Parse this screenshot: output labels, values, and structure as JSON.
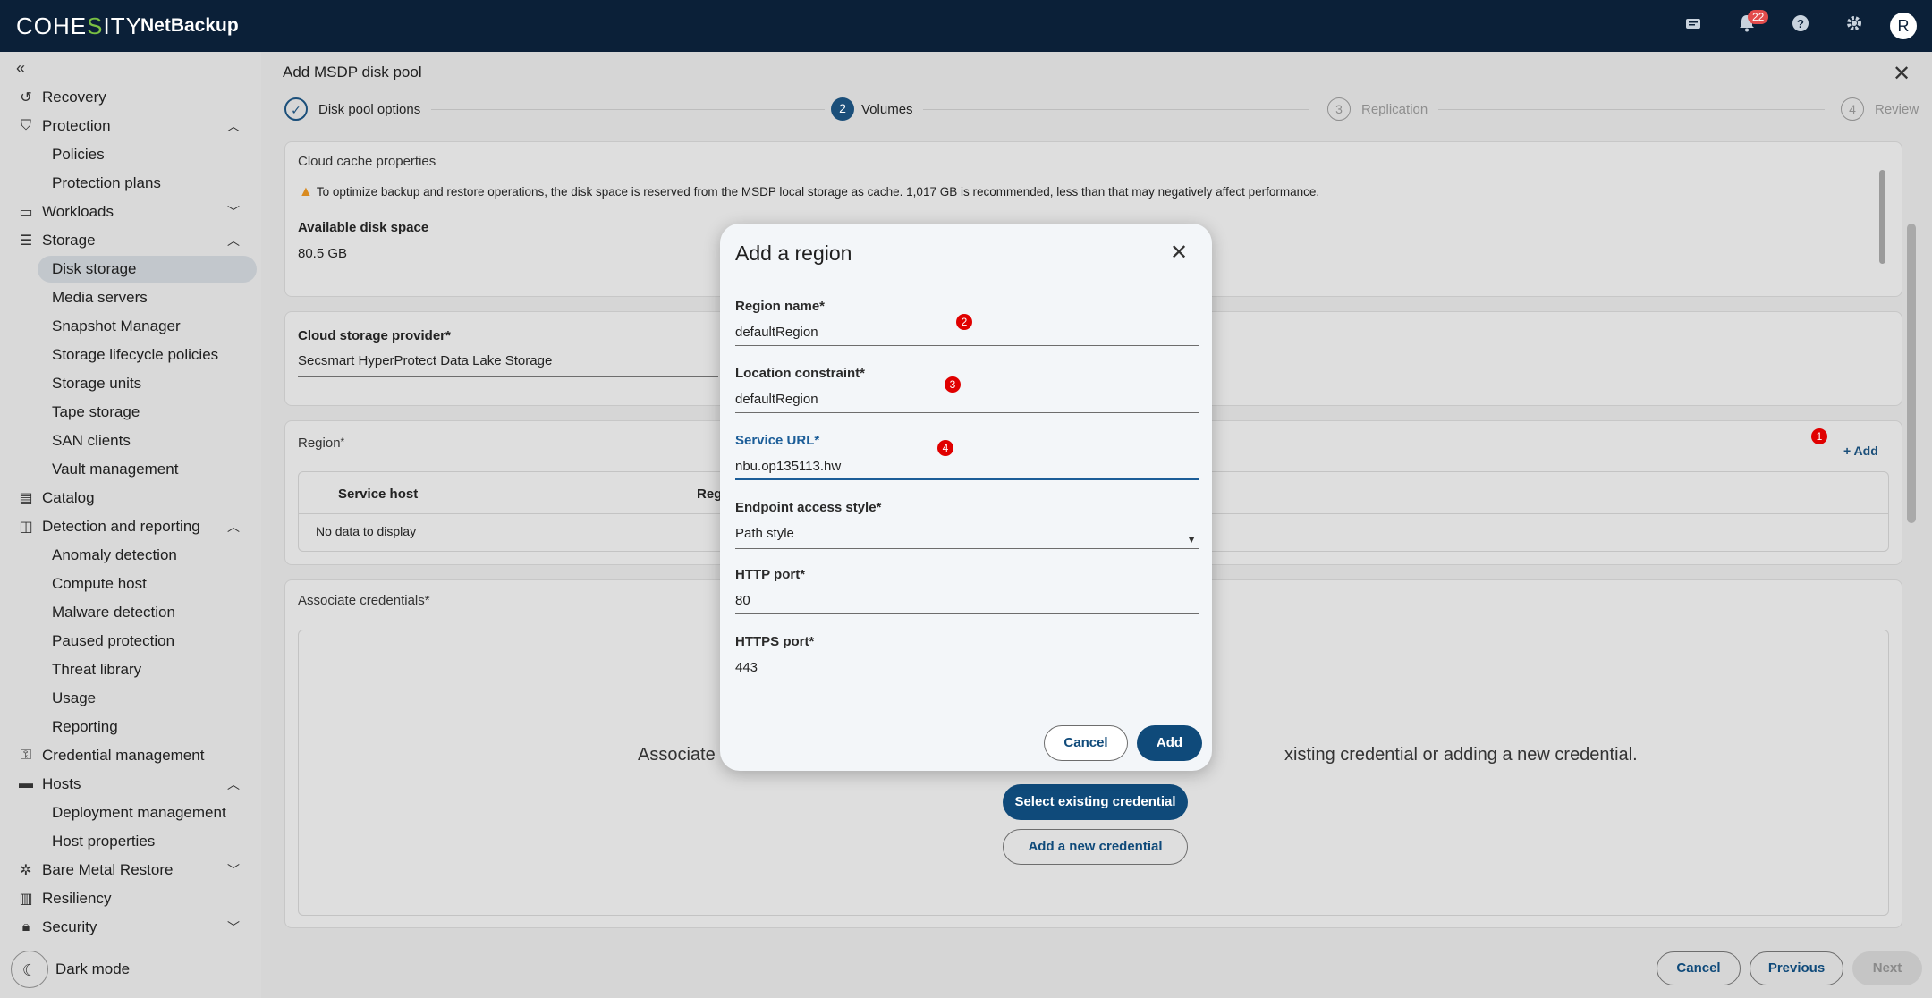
{
  "header": {
    "logo_prefix": "COHE",
    "logo_accent": "S",
    "logo_suffix": "ITY",
    "product": "NetBackup",
    "notification_count": "22",
    "avatar_initial": "R"
  },
  "sidebar": {
    "collapse_glyph": "«",
    "items": {
      "recovery": "Recovery",
      "protection": "Protection",
      "policies": "Policies",
      "protection_plans": "Protection plans",
      "workloads": "Workloads",
      "storage": "Storage",
      "disk_storage": "Disk storage",
      "media_servers": "Media servers",
      "snapshot_manager": "Snapshot Manager",
      "storage_lifecycle_policies": "Storage lifecycle policies",
      "storage_units": "Storage units",
      "tape_storage": "Tape storage",
      "san_clients": "SAN clients",
      "vault_management": "Vault management",
      "catalog": "Catalog",
      "detection_and_reporting": "Detection and reporting",
      "anomaly_detection": "Anomaly detection",
      "compute_host": "Compute host",
      "malware_detection": "Malware detection",
      "paused_protection": "Paused protection",
      "threat_library": "Threat library",
      "usage": "Usage",
      "reporting": "Reporting",
      "credential_management": "Credential management",
      "hosts": "Hosts",
      "deployment_management": "Deployment management",
      "host_properties": "Host properties",
      "bare_metal_restore": "Bare Metal Restore",
      "resiliency": "Resiliency",
      "security": "Security"
    },
    "dark_mode": "Dark mode"
  },
  "main": {
    "title": "Add MSDP disk pool",
    "steps": [
      {
        "num": "",
        "label": "Disk pool options"
      },
      {
        "num": "2",
        "label": "Volumes"
      },
      {
        "num": "3",
        "label": "Replication"
      },
      {
        "num": "4",
        "label": "Review"
      }
    ],
    "cloud_cache": {
      "title": "Cloud cache properties",
      "warning": "To optimize backup and restore operations, the disk space is reserved from the MSDP local storage as cache. 1,017 GB is recommended, less than that may negatively affect performance.",
      "available_label": "Available disk space",
      "available_value": "80.5 GB"
    },
    "provider": {
      "label": "Cloud storage provider*",
      "value": "Secsmart HyperProtect Data Lake Storage"
    },
    "region": {
      "title": "Region",
      "required": "*",
      "add": "+ Add",
      "columns": [
        "Service host",
        "Regi"
      ],
      "empty": "No data to display"
    },
    "credentials": {
      "title": "Associate credentials*",
      "text_left": "Associate c",
      "text_right": "xisting credential or adding a new credential.",
      "select_existing": "Select existing credential",
      "add_new": "Add a new credential"
    },
    "footer": {
      "cancel": "Cancel",
      "previous": "Previous",
      "next": "Next"
    },
    "markers": [
      "1",
      "2",
      "3",
      "4"
    ]
  },
  "modal": {
    "title": "Add a region",
    "fields": {
      "region_name": {
        "label": "Region name*",
        "value": "defaultRegion"
      },
      "location_constraint": {
        "label": "Location constraint*",
        "value": "defaultRegion"
      },
      "service_url": {
        "label": "Service URL*",
        "value": "nbu.op135113.hw"
      },
      "endpoint_style": {
        "label": "Endpoint access style*",
        "value": "Path style"
      },
      "http_port": {
        "label": "HTTP port*",
        "value": "80"
      },
      "https_port": {
        "label": "HTTPS port*",
        "value": "443"
      }
    },
    "cancel": "Cancel",
    "add": "Add"
  }
}
